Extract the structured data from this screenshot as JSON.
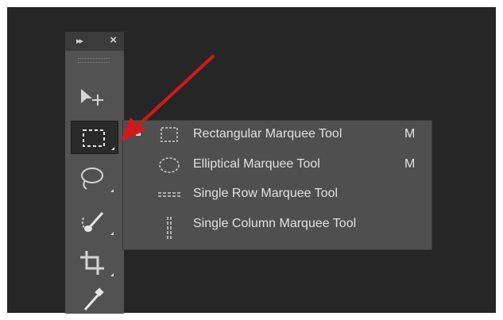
{
  "toolbar": {
    "collapse_glyph": "▸▸",
    "close_glyph": "×",
    "tools": [
      {
        "name": "move-tool",
        "icon": "move-icon"
      },
      {
        "name": "rectangular-marquee-tool",
        "icon": "rectangular-marquee-icon",
        "active": true
      },
      {
        "name": "lasso-tool",
        "icon": "lasso-icon"
      },
      {
        "name": "quick-selection-tool",
        "icon": "quick-selection-brush-icon"
      },
      {
        "name": "crop-tool",
        "icon": "crop-icon"
      },
      {
        "name": "eyedropper-tool",
        "icon": "eyedropper-icon"
      }
    ]
  },
  "flyout": {
    "items": [
      {
        "label": "Rectangular Marquee Tool",
        "shortcut": "M",
        "icon": "rectangular-marquee-icon",
        "selected": true
      },
      {
        "label": "Elliptical Marquee Tool",
        "shortcut": "M",
        "icon": "elliptical-marquee-icon",
        "selected": false
      },
      {
        "label": "Single Row Marquee Tool",
        "shortcut": "",
        "icon": "single-row-marquee-icon",
        "selected": false
      },
      {
        "label": "Single Column Marquee Tool",
        "shortcut": "",
        "icon": "single-column-marquee-icon",
        "selected": false
      }
    ]
  },
  "colors": {
    "background": "#262626",
    "panel": "#525252",
    "flyout": "#4f4f4f",
    "text": "#e0e0e0",
    "arrow": "#d11a1a"
  }
}
